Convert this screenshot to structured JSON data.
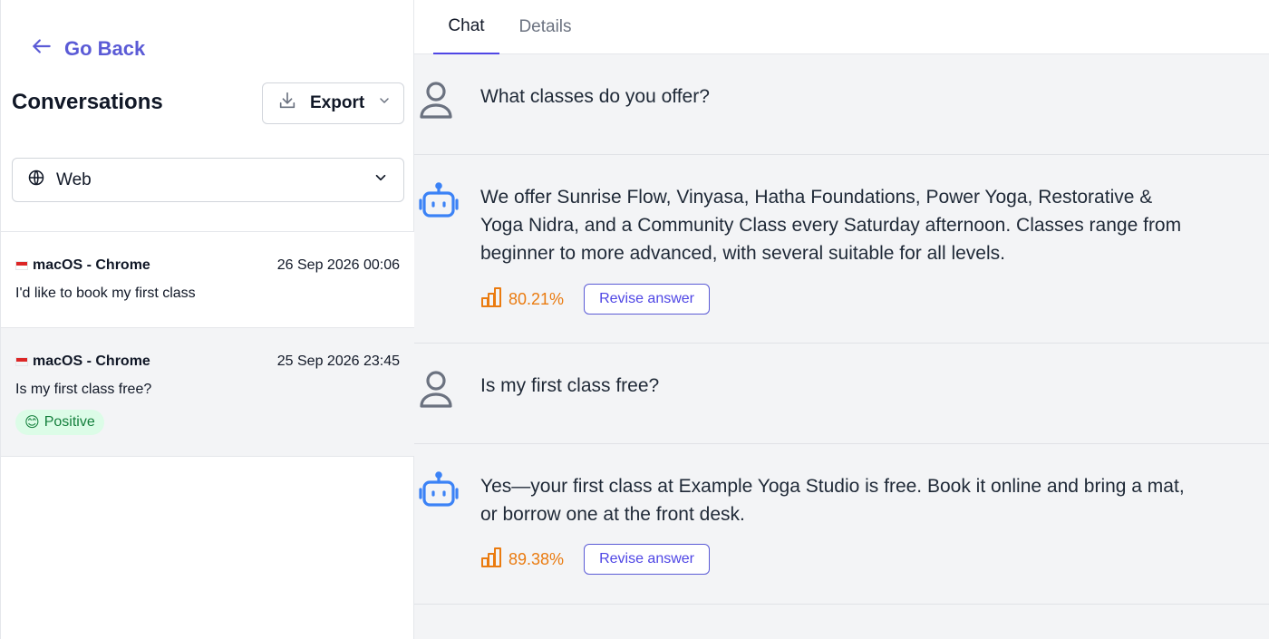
{
  "sidebar": {
    "go_back": "Go Back",
    "title": "Conversations",
    "export_label": "Export",
    "channel_select": "Web",
    "conversations": [
      {
        "device": "macOS - Chrome",
        "date": "26 Sep 2026 00:06",
        "preview": "I'd like to book my first class",
        "badge": ""
      },
      {
        "device": "macOS - Chrome",
        "date": "25 Sep 2026 23:45",
        "preview": "Is my first class free?",
        "badge": "Positive",
        "badge_emoji": "😊"
      }
    ]
  },
  "tabs": [
    {
      "label": "Chat",
      "active": true
    },
    {
      "label": "Details",
      "active": false
    }
  ],
  "messages": [
    {
      "role": "user",
      "text": "What classes do you offer?"
    },
    {
      "role": "bot",
      "text": "We offer Sunrise Flow, Vinyasa, Hatha Foundations, Power Yoga, Restorative & Yoga Nidra, and a Community Class every Saturday afternoon. Classes range from beginner to more advanced, with several suitable for all levels.",
      "score": "80.21%",
      "revise_label": "Revise answer"
    },
    {
      "role": "user",
      "text": "Is my first class free?"
    },
    {
      "role": "bot",
      "text": "Yes—your first class at Example Yoga Studio is free. Book it online and bring a mat, or borrow one at the front desk.",
      "score": "89.38%",
      "revise_label": "Revise answer"
    }
  ],
  "icons": {
    "back": "arrow-left-icon",
    "export": "download-icon",
    "chevron": "chevron-down-icon",
    "globe": "globe-icon",
    "user": "user-icon",
    "bot": "robot-icon",
    "score": "bar-chart-icon"
  },
  "colors": {
    "accent": "#5b5bd6",
    "score": "#ea7b10",
    "bot_icon": "#3b82f6",
    "positive_bg": "#dcfce7",
    "positive_text": "#15803d"
  }
}
